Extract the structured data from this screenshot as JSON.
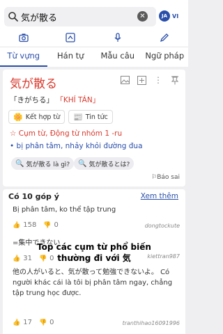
{
  "search": {
    "query": "気が散る",
    "clear_icon": "close-icon",
    "lang_from": "JA",
    "lang_to": "VI"
  },
  "modes": [
    "camera-icon",
    "handwriting-icon",
    "microphone-icon",
    "pen-icon"
  ],
  "tabs": [
    {
      "label": "Từ vựng",
      "active": true
    },
    {
      "label": "Hán tự",
      "active": false
    },
    {
      "label": "Mẫu câu",
      "active": false
    },
    {
      "label": "Ngữ pháp",
      "active": false
    }
  ],
  "entry": {
    "word": "気が散る",
    "reading": "「きがちる」",
    "sino_viet": "「KHÍ TÁN」",
    "chip_kanji": "Kết hợp từ",
    "chip_news": "Tin tức",
    "word_type": "☆ Cụm từ, Động từ nhóm 1 -ru",
    "meaning": "• bị phân tâm, nhảy khỏi đường đua",
    "ask_1": "気が散る là gì?",
    "ask_2": "気が散るとは?",
    "report": "Báo sai"
  },
  "comments": {
    "header": "Có 10 góp ý",
    "see_more": "Xem thêm",
    "items": [
      {
        "text": "Bị phân tâm, ko thể tập trung",
        "up": "158",
        "down": "0",
        "author": "dongtockute"
      },
      {
        "text": "=集中できない",
        "up": "31",
        "down": "0",
        "author": "kiettran987"
      },
      {
        "text": "他の人がいると、気が散って勉強できないよ。 Có người khác cái là tôi bị phân tâm ngay, chẳng tập trung học được.",
        "up": "17",
        "down": "0",
        "author": "tranthihao16091996"
      }
    ]
  },
  "overlay": {
    "line1": "Top các cụm từ phổ biến",
    "line2": "thường đi với 気"
  },
  "colors": {
    "accent": "#2a4faa",
    "headword": "#d93a2e"
  }
}
